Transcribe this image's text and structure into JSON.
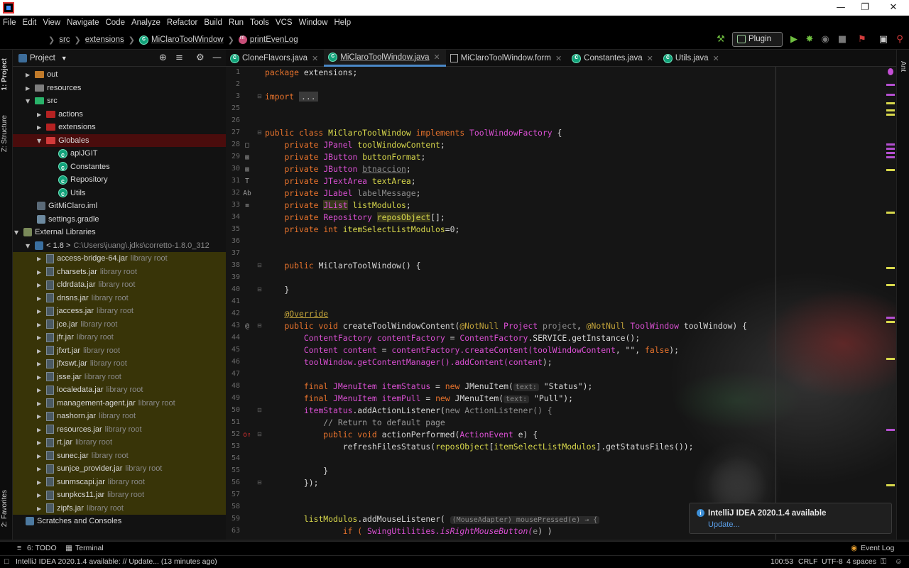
{
  "menu": [
    "File",
    "Edit",
    "View",
    "Navigate",
    "Code",
    "Analyze",
    "Refactor",
    "Build",
    "Run",
    "Tools",
    "VCS",
    "Window",
    "Help"
  ],
  "breadcrumb": {
    "items": [
      "src",
      "extensions",
      "MiClaroToolWindow",
      "printEvenLog"
    ]
  },
  "toolbar": {
    "run_config": "Plugin"
  },
  "left_strip": {
    "project": "1: Project",
    "structure": "Z: Structure",
    "favorites": "2: Favorites"
  },
  "right_strip": {
    "ant": "Ant"
  },
  "project_panel": {
    "title": "Project"
  },
  "tree": {
    "out": "out",
    "resources": "resources",
    "src": "src",
    "actions": "actions",
    "extensions": "extensions",
    "globales": "Globales",
    "apijgit": "apiJGIT",
    "constantes": "Constantes",
    "repository": "Repository",
    "utils": "Utils",
    "iml": "GitMiClaro.iml",
    "gradle": "settings.gradle",
    "ext_libs": "External Libraries",
    "jdk": "< 1.8 >",
    "jdk_path": "C:\\Users\\juang\\.jdks\\corretto-1.8.0_312",
    "jar_suffix": "library root",
    "jars": [
      "access-bridge-64.jar",
      "charsets.jar",
      "cldrdata.jar",
      "dnsns.jar",
      "jaccess.jar",
      "jce.jar",
      "jfr.jar",
      "jfxrt.jar",
      "jfxswt.jar",
      "jsse.jar",
      "localedata.jar",
      "management-agent.jar",
      "nashorn.jar",
      "resources.jar",
      "rt.jar",
      "sunec.jar",
      "sunjce_provider.jar",
      "sunmscapi.jar",
      "sunpkcs11.jar",
      "zipfs.jar"
    ],
    "scratches": "Scratches and Consoles"
  },
  "tabs": [
    "CloneFlavors.java",
    "MiClaroToolWindow.java",
    "MiClaroToolWindow.form",
    "Constantes.java",
    "Utils.java"
  ],
  "editor": {
    "line_numbers": [
      "1",
      "2",
      "3",
      "25",
      "26",
      "27",
      "28",
      "29",
      "30",
      "31",
      "32",
      "33",
      "34",
      "35",
      "36",
      "37",
      "38",
      "39",
      "40",
      "41",
      "42",
      "43",
      "44",
      "45",
      "46",
      "47",
      "48",
      "49",
      "50",
      "51",
      "52",
      "53",
      "54",
      "55",
      "56",
      "57",
      "58",
      "59",
      "63"
    ],
    "code": {
      "l1a": "package",
      "l1b": " extensions;",
      "l3a": "import",
      "l3b": "...",
      "l27a": "public class ",
      "l27b": "MiClaroToolWindow",
      "l27c": " implements ",
      "l27d": "ToolWindowFactory",
      "l27e": " {",
      "l28a": "private ",
      "l28b": "JPanel",
      "l28c": "toolWindowContent",
      "l29b": "JButton",
      "l29c": "buttonFormat",
      "l30c": "btnaccion",
      "l31b": "JTextArea",
      "l31c": "textArea",
      "l32b": "JLabel",
      "l32c": "labelMessage",
      "l33b": "JList",
      "l33c": "listModulos",
      "l34b": "Repository",
      "l34c": "reposObject",
      "l34d": "[];",
      "l35b": "int",
      "l35c": "itemSelectListModulos",
      "l35d": "=0;",
      "l38a": "public ",
      "l38b": "MiClaroToolWindow() {",
      "l40": "}",
      "l42": "@Override",
      "l43a": "public void ",
      "l43b": "createToolWindowContent(",
      "l43c": "@NotNull",
      "l43d": " Project ",
      "l43e": "project",
      "l43f": ", ",
      "l43g": "ToolWindow",
      "l43h": " toolWindow) {",
      "l44a": "ContentFactory",
      "l44b": " contentFactory",
      "l44c": " = ",
      "l44d": ".SERVICE.getInstance();",
      "l45a": "Content",
      "l45b": " content",
      "l45c": "contentFactory",
      "l45d": ".createContent(",
      "l45e": "toolWindowContent",
      "l45f": ", \"\", ",
      "l45g": "false",
      "l45h": ");",
      "l46a": "toolWindow",
      "l46b": ".getContentManager().addContent(",
      "l46c": "content",
      "l46d": ");",
      "l48a": "final ",
      "l48b": "JMenuItem",
      "l48c": " itemStatus",
      "l48d": " = ",
      "l48e": "new ",
      "l48f": "JMenuItem(",
      "hint_text": "text:",
      "l48g": " \"Status\");",
      "l49c": " itemPull",
      "l49g": " \"Pull\");",
      "l50a": "itemStatus",
      "l50b": ".addActionListener(",
      "l50c": "new ActionListener() {",
      "l51": "// Return to default page",
      "l52a": "public void ",
      "l52b": "actionPerformed(",
      "l52c": "ActionEvent",
      "l52d": " e) {",
      "l53a": "refreshFilesStatus(",
      "l53b": "reposObject",
      "l53c": "[",
      "l53d": "itemSelectListModulos",
      "l53e": "].getStatusFiles());",
      "l55": "}",
      "l56": "});",
      "l59a": "listModulos",
      "l59b": ".addMouseListener(",
      "l59c": "(MouseAdapter) mousePressed(e) → {",
      "l63a": "if ( ",
      "l63b": "SwingUtilities",
      "l63c": ".isRightMouseButton(",
      "l63d": "e",
      "l63e": ") )"
    }
  },
  "notification": {
    "title": "IntelliJ IDEA 2020.1.4 available",
    "link": "Update..."
  },
  "bottom_tools": {
    "todo": "6: TODO",
    "terminal": "Terminal",
    "event_log": "Event Log"
  },
  "status": {
    "message": "IntelliJ IDEA 2020.1.4 available: // Update... (13 minutes ago)",
    "position": "100:53",
    "line_sep": "CRLF",
    "encoding": "UTF-8",
    "indent": "4 spaces"
  },
  "colors": {
    "accent": "#4a88c7",
    "keyword": "#e8732c",
    "type": "#d94fd2",
    "field": "#d8d84c",
    "jar_row": "#383408",
    "selected_row": "#4a0c0c"
  }
}
